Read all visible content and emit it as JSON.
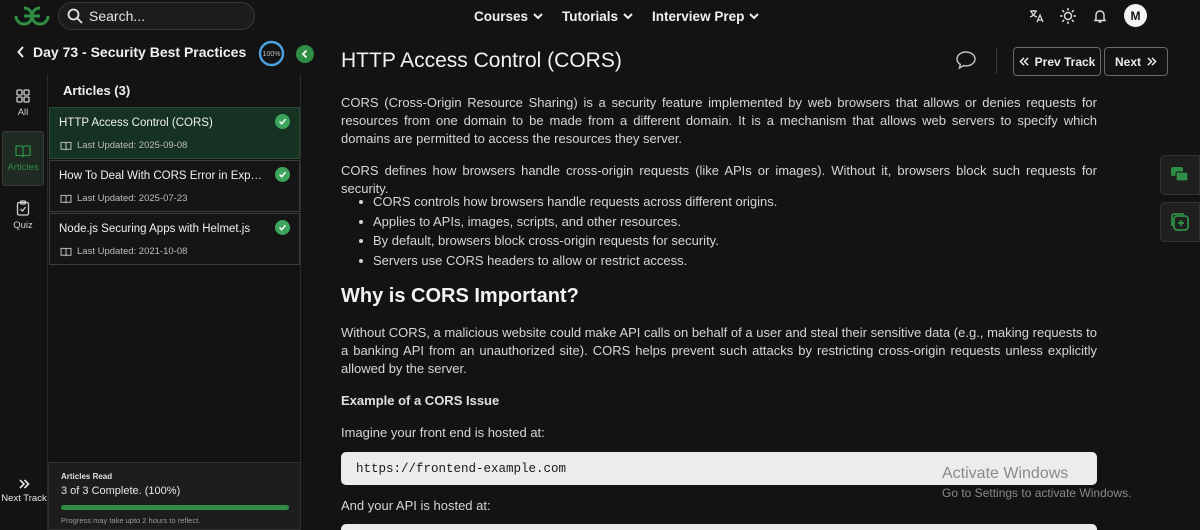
{
  "header": {
    "search_placeholder": "Search...",
    "nav": [
      "Courses",
      "Tutorials",
      "Interview Prep"
    ],
    "avatar_letter": "M"
  },
  "track": {
    "title": "Day 73 - Security Best Practices",
    "progress_label": "100%",
    "progress": 100
  },
  "rail": {
    "all": "All",
    "articles": "Articles",
    "quiz": "Quiz",
    "next_track": "Next Track"
  },
  "articles_panel": {
    "heading": "Articles (3)",
    "items": [
      {
        "title": "HTTP Access Control (CORS)",
        "date": "Last Updated: 2025-09-08"
      },
      {
        "title": "How To Deal With CORS Error in Express Node.js Project",
        "date": "Last Updated: 2025-07-23"
      },
      {
        "title": "Node.js Securing Apps with Helmet.js",
        "date": "Last Updated: 2021-10-08"
      }
    ],
    "read": {
      "heading": "Articles Read",
      "value": "3 of 3 Complete. (100%)",
      "percent": 100,
      "note": "Progress may take upto 2 hours to reflect."
    }
  },
  "article": {
    "title": "HTTP Access Control (CORS)",
    "prev_label": "Prev Track",
    "next_label": "Next",
    "p1": "CORS (Cross-Origin Resource Sharing) is a security feature implemented by web browsers that allows or denies requests for resources from one domain to be made from a different domain. It is a mechanism that allows web servers to specify which domains are permitted to access the resources they server.",
    "p2": "CORS defines how browsers handle cross-origin requests (like APIs or images). Without it, browsers block such requests for security.",
    "bullets": [
      "CORS controls how browsers handle requests across different origins.",
      "Applies to APIs, images, scripts, and other resources.",
      "By default, browsers block cross-origin requests for security.",
      "Servers use CORS headers to allow or restrict access."
    ],
    "h2": "Why is CORS Important?",
    "p3": "Without CORS, a malicious website could make API calls on behalf of a user and steal their sensitive data (e.g., making requests to a banking API from an unauthorized site). CORS helps prevent such attacks by restricting cross-origin requests unless explicitly allowed by the server.",
    "p4": "Example of a CORS Issue",
    "p5": "Imagine your front end is hosted at:",
    "code1": "https://frontend-example.com",
    "p6": "And your API is hosted at:"
  },
  "watermark": {
    "line1": "Activate Windows",
    "line2": "Go to Settings to activate Windows."
  },
  "colors": {
    "accent": "#2f8d46",
    "background": "#131313",
    "active_article": "#163222"
  }
}
